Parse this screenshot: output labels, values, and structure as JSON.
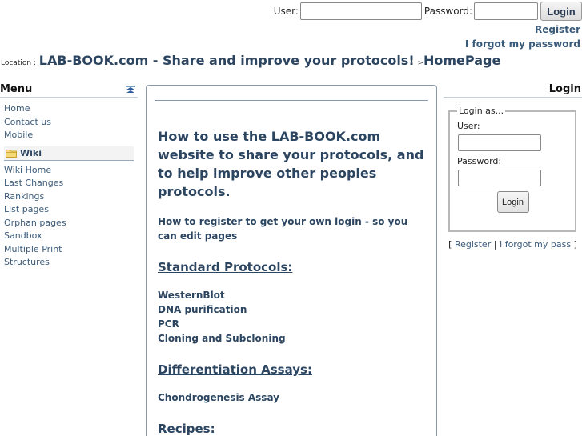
{
  "topbar": {
    "user_label": "User:",
    "password_label": "Password:",
    "user_value": "",
    "password_value": "",
    "login_label": "Login",
    "register_link": "Register",
    "forgot_link": "I forgot my password"
  },
  "location": {
    "label": "Location :",
    "site": "LAB-BOOK.com - Share and improve your protocols!",
    "separator": ">",
    "page": "HomePage"
  },
  "menu": {
    "title": "Menu",
    "items": [
      "Home",
      "Contact us",
      "Mobile"
    ],
    "wiki_label": "Wiki",
    "wiki_items": [
      "Wiki Home",
      "Last Changes",
      "Rankings",
      "List pages",
      "Orphan pages",
      "Sandbox",
      "Multiple Print",
      "Structures"
    ]
  },
  "content": {
    "heading": "How to use the LAB-BOOK.com website to share your protocols, and to help improve other peoples protocols.",
    "register_text": "How to register to get your own login - so you can edit pages",
    "sections": [
      {
        "title": "Standard Protocols:",
        "links": [
          "WesternBlot",
          "DNA purification",
          "PCR",
          "Cloning and Subcloning"
        ]
      },
      {
        "title": "Differentiation Assays:",
        "links": [
          "Chondrogenesis Assay"
        ]
      },
      {
        "title": "Recipes:",
        "links": []
      }
    ]
  },
  "login_panel": {
    "title": "Login",
    "legend": "Login as...",
    "user_label": "User:",
    "password_label": "Password:",
    "user_value": "",
    "password_value": "",
    "button": "Login",
    "bracket_open": "[",
    "register": "Register",
    "divider": "|",
    "forgot": "I forgot my pass",
    "bracket_close": "]"
  },
  "colors": {
    "link": "#3a5a7a",
    "heading": "#2c4560",
    "border": "#8a9aab"
  }
}
